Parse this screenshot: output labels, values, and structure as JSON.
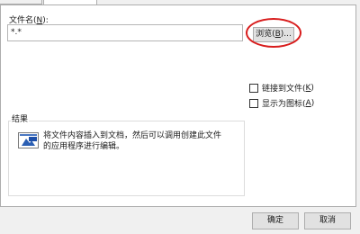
{
  "file_name": {
    "label": "文件名(",
    "label_key": "N",
    "label_end": "):",
    "value": "*.*"
  },
  "browse_button": {
    "label": "浏览(",
    "key": "B",
    "end": ")..."
  },
  "options": [
    {
      "label": "链接到文件(",
      "key": "K",
      "end": ")",
      "checked": false
    },
    {
      "label": "显示为图标(",
      "key": "A",
      "end": ")",
      "checked": false
    }
  ],
  "result": {
    "title": "结果",
    "icon": "insert-object-icon",
    "description": "将文件内容插入到文档，然后可以调用创建此文件的应用程序进行编辑。"
  },
  "footer": {
    "ok_label": "确定",
    "cancel_label": "取消"
  },
  "highlight_color": "#d81d1d"
}
